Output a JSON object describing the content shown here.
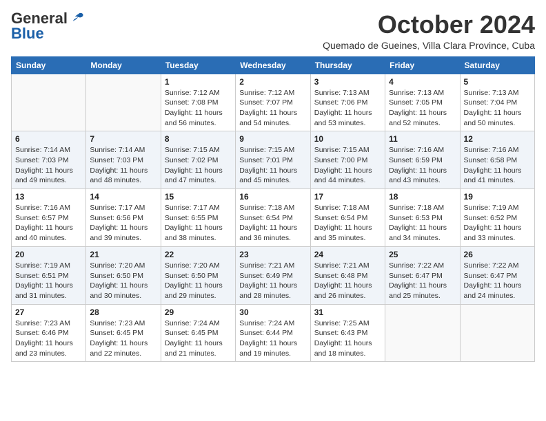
{
  "header": {
    "logo_general": "General",
    "logo_blue": "Blue",
    "month_title": "October 2024",
    "location": "Quemado de Gueines, Villa Clara Province, Cuba"
  },
  "weekdays": [
    "Sunday",
    "Monday",
    "Tuesday",
    "Wednesday",
    "Thursday",
    "Friday",
    "Saturday"
  ],
  "weeks": [
    [
      {
        "day": "",
        "info": ""
      },
      {
        "day": "",
        "info": ""
      },
      {
        "day": "1",
        "info": "Sunrise: 7:12 AM\nSunset: 7:08 PM\nDaylight: 11 hours\nand 56 minutes."
      },
      {
        "day": "2",
        "info": "Sunrise: 7:12 AM\nSunset: 7:07 PM\nDaylight: 11 hours\nand 54 minutes."
      },
      {
        "day": "3",
        "info": "Sunrise: 7:13 AM\nSunset: 7:06 PM\nDaylight: 11 hours\nand 53 minutes."
      },
      {
        "day": "4",
        "info": "Sunrise: 7:13 AM\nSunset: 7:05 PM\nDaylight: 11 hours\nand 52 minutes."
      },
      {
        "day": "5",
        "info": "Sunrise: 7:13 AM\nSunset: 7:04 PM\nDaylight: 11 hours\nand 50 minutes."
      }
    ],
    [
      {
        "day": "6",
        "info": "Sunrise: 7:14 AM\nSunset: 7:03 PM\nDaylight: 11 hours\nand 49 minutes."
      },
      {
        "day": "7",
        "info": "Sunrise: 7:14 AM\nSunset: 7:03 PM\nDaylight: 11 hours\nand 48 minutes."
      },
      {
        "day": "8",
        "info": "Sunrise: 7:15 AM\nSunset: 7:02 PM\nDaylight: 11 hours\nand 47 minutes."
      },
      {
        "day": "9",
        "info": "Sunrise: 7:15 AM\nSunset: 7:01 PM\nDaylight: 11 hours\nand 45 minutes."
      },
      {
        "day": "10",
        "info": "Sunrise: 7:15 AM\nSunset: 7:00 PM\nDaylight: 11 hours\nand 44 minutes."
      },
      {
        "day": "11",
        "info": "Sunrise: 7:16 AM\nSunset: 6:59 PM\nDaylight: 11 hours\nand 43 minutes."
      },
      {
        "day": "12",
        "info": "Sunrise: 7:16 AM\nSunset: 6:58 PM\nDaylight: 11 hours\nand 41 minutes."
      }
    ],
    [
      {
        "day": "13",
        "info": "Sunrise: 7:16 AM\nSunset: 6:57 PM\nDaylight: 11 hours\nand 40 minutes."
      },
      {
        "day": "14",
        "info": "Sunrise: 7:17 AM\nSunset: 6:56 PM\nDaylight: 11 hours\nand 39 minutes."
      },
      {
        "day": "15",
        "info": "Sunrise: 7:17 AM\nSunset: 6:55 PM\nDaylight: 11 hours\nand 38 minutes."
      },
      {
        "day": "16",
        "info": "Sunrise: 7:18 AM\nSunset: 6:54 PM\nDaylight: 11 hours\nand 36 minutes."
      },
      {
        "day": "17",
        "info": "Sunrise: 7:18 AM\nSunset: 6:54 PM\nDaylight: 11 hours\nand 35 minutes."
      },
      {
        "day": "18",
        "info": "Sunrise: 7:18 AM\nSunset: 6:53 PM\nDaylight: 11 hours\nand 34 minutes."
      },
      {
        "day": "19",
        "info": "Sunrise: 7:19 AM\nSunset: 6:52 PM\nDaylight: 11 hours\nand 33 minutes."
      }
    ],
    [
      {
        "day": "20",
        "info": "Sunrise: 7:19 AM\nSunset: 6:51 PM\nDaylight: 11 hours\nand 31 minutes."
      },
      {
        "day": "21",
        "info": "Sunrise: 7:20 AM\nSunset: 6:50 PM\nDaylight: 11 hours\nand 30 minutes."
      },
      {
        "day": "22",
        "info": "Sunrise: 7:20 AM\nSunset: 6:50 PM\nDaylight: 11 hours\nand 29 minutes."
      },
      {
        "day": "23",
        "info": "Sunrise: 7:21 AM\nSunset: 6:49 PM\nDaylight: 11 hours\nand 28 minutes."
      },
      {
        "day": "24",
        "info": "Sunrise: 7:21 AM\nSunset: 6:48 PM\nDaylight: 11 hours\nand 26 minutes."
      },
      {
        "day": "25",
        "info": "Sunrise: 7:22 AM\nSunset: 6:47 PM\nDaylight: 11 hours\nand 25 minutes."
      },
      {
        "day": "26",
        "info": "Sunrise: 7:22 AM\nSunset: 6:47 PM\nDaylight: 11 hours\nand 24 minutes."
      }
    ],
    [
      {
        "day": "27",
        "info": "Sunrise: 7:23 AM\nSunset: 6:46 PM\nDaylight: 11 hours\nand 23 minutes."
      },
      {
        "day": "28",
        "info": "Sunrise: 7:23 AM\nSunset: 6:45 PM\nDaylight: 11 hours\nand 22 minutes."
      },
      {
        "day": "29",
        "info": "Sunrise: 7:24 AM\nSunset: 6:45 PM\nDaylight: 11 hours\nand 21 minutes."
      },
      {
        "day": "30",
        "info": "Sunrise: 7:24 AM\nSunset: 6:44 PM\nDaylight: 11 hours\nand 19 minutes."
      },
      {
        "day": "31",
        "info": "Sunrise: 7:25 AM\nSunset: 6:43 PM\nDaylight: 11 hours\nand 18 minutes."
      },
      {
        "day": "",
        "info": ""
      },
      {
        "day": "",
        "info": ""
      }
    ]
  ]
}
